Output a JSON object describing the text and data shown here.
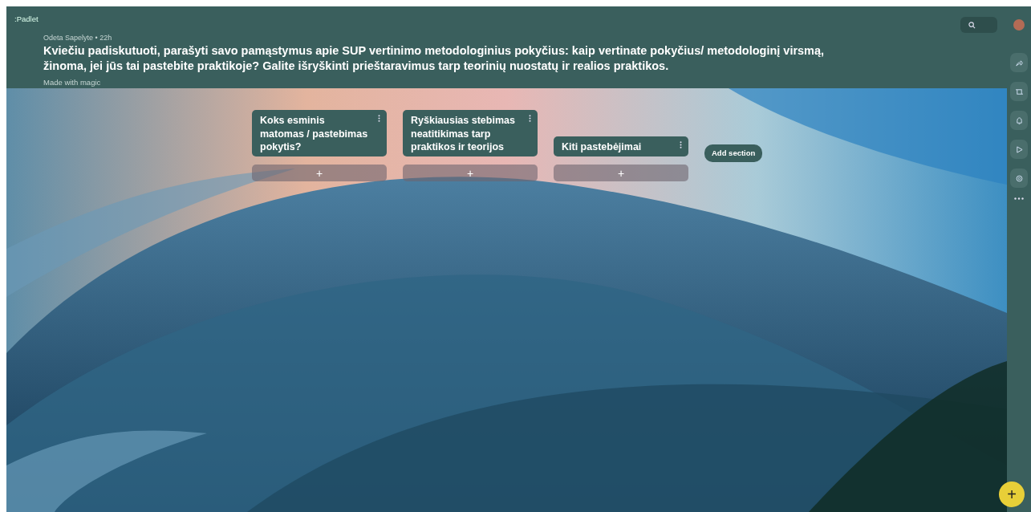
{
  "header": {
    "logo": ":Padlet",
    "author": "Odeta Sapelyte",
    "time": "• 22h",
    "title": "Kviečiu padiskutuoti, parašyti savo pamąstymus apie SUP vertinimo metodologinius pokyčius: kaip vertinate pokyčius/ metodologinį virsmą, žinoma, jei jūs tai pastebite praktikoje? Galite išryškinti prieštaravimus tarp teorinių nuostatų ir realios praktikos.",
    "subtitle": "Made with magic"
  },
  "sections": [
    {
      "title": "Koks esminis matomas / pastebimas pokytis?",
      "add_label": "+"
    },
    {
      "title": "Ryškiausias stebimas neatitikimas tarp praktikos ir teorijos",
      "add_label": "+"
    },
    {
      "title": "Kiti pastebėjimai",
      "add_label": "+"
    }
  ],
  "add_section": "Add section",
  "fab": "+"
}
